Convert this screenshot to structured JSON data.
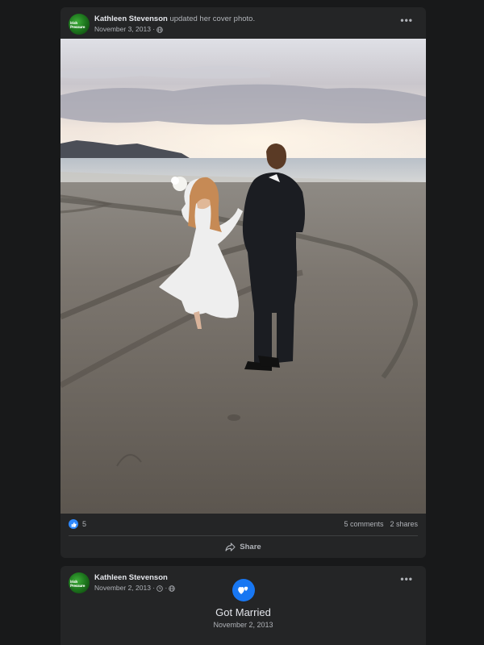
{
  "post1": {
    "author": "Kathleen Stevenson",
    "action": "updated her cover photo.",
    "date": "November 3, 2013",
    "avatar_text": "Irish Pressure",
    "menu": "•••",
    "likes": "5",
    "comments": "5 comments",
    "shares": "2 shares",
    "share_label": "Share"
  },
  "post2": {
    "author": "Kathleen Stevenson",
    "date": "November 2, 2013",
    "avatar_text": "Irish Pressure",
    "menu": "•••",
    "event_title": "Got Married",
    "event_date": "November 2, 2013"
  },
  "colors": {
    "background": "#18191a",
    "card": "#242526",
    "accent": "#2d88ff",
    "text": "#e4e6eb",
    "secondary": "#b0b3b8"
  }
}
